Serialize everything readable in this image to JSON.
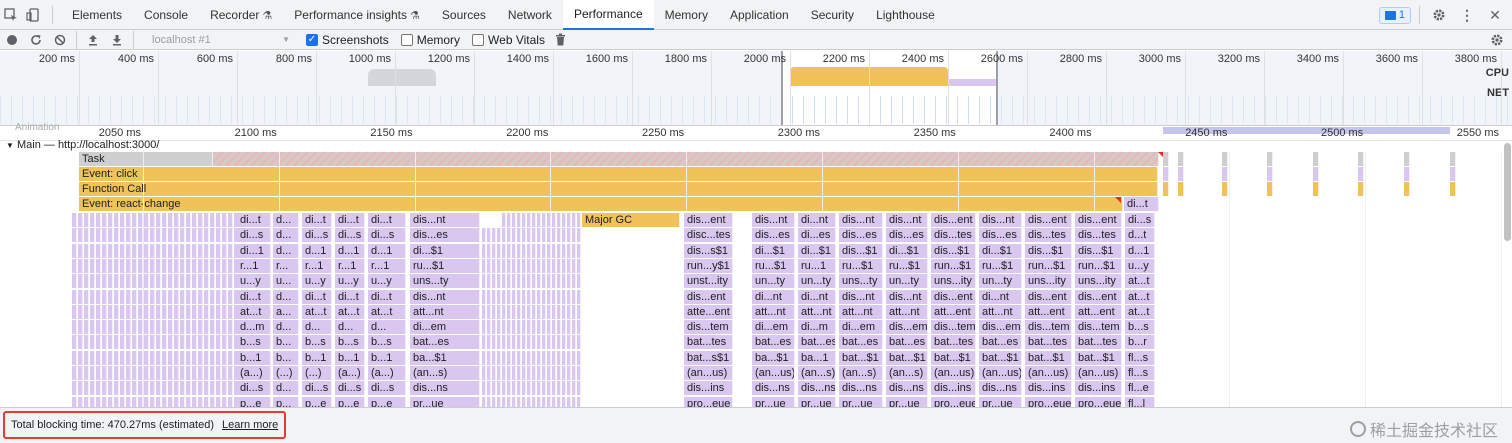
{
  "tabs": [
    {
      "label": "Elements"
    },
    {
      "label": "Console"
    },
    {
      "label": "Recorder",
      "flask": "⚗"
    },
    {
      "label": "Performance insights",
      "flask": "⚗"
    },
    {
      "label": "Sources"
    },
    {
      "label": "Network"
    },
    {
      "label": "Performance",
      "active": true
    },
    {
      "label": "Memory"
    },
    {
      "label": "Application"
    },
    {
      "label": "Security"
    },
    {
      "label": "Lighthouse"
    }
  ],
  "issues_count": "1",
  "toolbar": {
    "profile_placeholder": "localhost #1",
    "screenshots_label": "Screenshots",
    "screenshots_checked": true,
    "memory_label": "Memory",
    "webvitals_label": "Web Vitals"
  },
  "overview": {
    "ticks": [
      "200 ms",
      "400 ms",
      "600 ms",
      "800 ms",
      "1000 ms",
      "1200 ms",
      "1400 ms",
      "1600 ms",
      "1800 ms",
      "2000 ms",
      "2200 ms",
      "2400 ms",
      "2600 ms",
      "2800 ms",
      "3000 ms",
      "3200 ms",
      "3400 ms",
      "3600 ms",
      "3800 ms"
    ],
    "cpu_label": "CPU",
    "net_label": "NET"
  },
  "ruler": {
    "animation_label": "Animation",
    "ticks": [
      "2050 ms",
      "2100 ms",
      "2150 ms",
      "2200 ms",
      "2250 ms",
      "2300 ms",
      "2350 ms",
      "2400 ms",
      "2450 ms",
      "2500 ms",
      "2550 ms"
    ]
  },
  "main_track": {
    "label": "Main — http://localhost:3000/"
  },
  "flame": {
    "task_label": "Task",
    "event_click": "Event: click",
    "function_call": "Function Call",
    "react_change": "Event: react-change",
    "major_gc": "Major GC",
    "corner_label": "di...t"
  },
  "columns": [
    [
      "di...t",
      "di...s",
      "di...1",
      "r...1",
      "u...y",
      "di...t",
      "at...t",
      "d...m",
      "b...s",
      "b...1",
      "(a...)",
      "di...s",
      "p...e"
    ],
    [
      "d...",
      "d...",
      "d...",
      "r...",
      "u...",
      "d...",
      "a...",
      "d...",
      "b...",
      "b...",
      "(...)",
      "d...",
      "p..."
    ],
    [
      "di...t",
      "di...s",
      "d...1",
      "r...1",
      "u...y",
      "di...t",
      "at...t",
      "d...",
      "b...s",
      "b...1",
      "(...)",
      "di...s",
      "p...e"
    ],
    [
      "di...t",
      "di...s",
      "d...1",
      "r...1",
      "u...y",
      "di...t",
      "at...t",
      "d...",
      "b...s",
      "b...1",
      "(a...)",
      "di...s",
      "p...e"
    ],
    [
      "di...t",
      "di...s",
      "d...1",
      "r...1",
      "u...y",
      "di...t",
      "at...t",
      "d...",
      "b...s",
      "b...1",
      "(a...)",
      "di...s",
      "p...e"
    ],
    [
      "dis...nt",
      "dis...es",
      "di...$1",
      "ru...$1",
      "uns...ty",
      "dis...nt",
      "att...nt",
      "di...em",
      "bat...es",
      "ba...$1",
      "(an...s)",
      "dis...ns",
      "pr...ue"
    ],
    [
      "dis...ent",
      "disc...tes",
      "dis...s$1",
      "run...y$1",
      "unst...ity",
      "dis...ent",
      "atte...ent",
      "dis...tem",
      "bat...tes",
      "bat...s$1",
      "(an...us)",
      "dis...ins",
      "pro...eue"
    ],
    [
      "dis...nt",
      "dis...es",
      "di...$1",
      "ru...$1",
      "un...ty",
      "di...nt",
      "att...nt",
      "di...em",
      "bat...es",
      "ba...$1",
      "(an...us)",
      "dis...ns",
      "pr...ue"
    ],
    [
      "di...nt",
      "di...es",
      "di...$1",
      "ru...1",
      "un...ty",
      "di...nt",
      "att...nt",
      "di...m",
      "bat...es",
      "ba...1",
      "(an...s)",
      "dis...ns",
      "pr...ue"
    ],
    [
      "dis...nt",
      "dis...es",
      "dis...$1",
      "ru...$1",
      "uns...ty",
      "dis...nt",
      "att...nt",
      "di...em",
      "bat...es",
      "bat...$1",
      "(an...s)",
      "dis...ns",
      "pr...ue"
    ],
    [
      "dis...nt",
      "dis...es",
      "di...$1",
      "ru...$1",
      "un...ty",
      "dis...nt",
      "att...nt",
      "dis...em",
      "bat...es",
      "bat...$1",
      "(an...s)",
      "dis...ns",
      "pr...ue"
    ],
    [
      "dis...ent",
      "dis...tes",
      "dis...$1",
      "run...$1",
      "uns...ity",
      "dis...ent",
      "att...ent",
      "dis...tem",
      "bat...tes",
      "bat...$1",
      "(an...us)",
      "dis...ins",
      "pro...eue"
    ],
    [
      "dis...nt",
      "dis...es",
      "di...$1",
      "ru...$1",
      "un...ty",
      "di...nt",
      "att...nt",
      "dis...em",
      "bat...es",
      "bat...$1",
      "(an...us)",
      "dis...ns",
      "pr...ue"
    ],
    [
      "dis...ent",
      "dis...tes",
      "dis...$1",
      "run...$1",
      "uns...ity",
      "dis...ent",
      "att...ent",
      "dis...tem",
      "bat...tes",
      "bat...$1",
      "(an...us)",
      "dis...ins",
      "pro...eue"
    ],
    [
      "dis...ent",
      "dis...tes",
      "dis...$1",
      "run...$1",
      "uns...ity",
      "dis...ent",
      "att...ent",
      "dis...tem",
      "bat...tes",
      "bat...$1",
      "(an...us)",
      "dis...ins",
      "pro...eue"
    ],
    [
      "di...s",
      "d...t",
      "d...1",
      "u...y",
      "at...t",
      "at...t",
      "at...t",
      "b...s",
      "b...r",
      "fl...s",
      "fl...s",
      "fl...e",
      "fl...l"
    ]
  ],
  "footer": {
    "tbt_text": "Total blocking time: 470.27ms (estimated)",
    "learn_more": "Learn more",
    "watermark": "稀土掘金技术社区"
  }
}
